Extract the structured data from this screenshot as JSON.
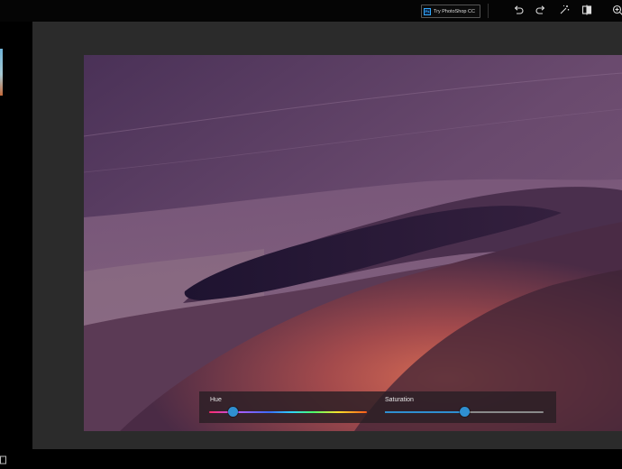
{
  "toolbar": {
    "try_photoshop_label": "Try PhotoShop CC",
    "ps_badge": "Ps",
    "icons": [
      "undo-icon",
      "redo-icon",
      "auto-fix-icon",
      "compare-icon",
      "zoom-icon"
    ]
  },
  "adjustments": {
    "hue": {
      "label": "Hue",
      "value": 0.15
    },
    "saturation": {
      "label": "Saturation",
      "value": 0.5
    }
  },
  "colors": {
    "accent": "#2f8fd0",
    "canvas_bg": "#2b2b2b",
    "toolbar_bg": "#050505"
  }
}
